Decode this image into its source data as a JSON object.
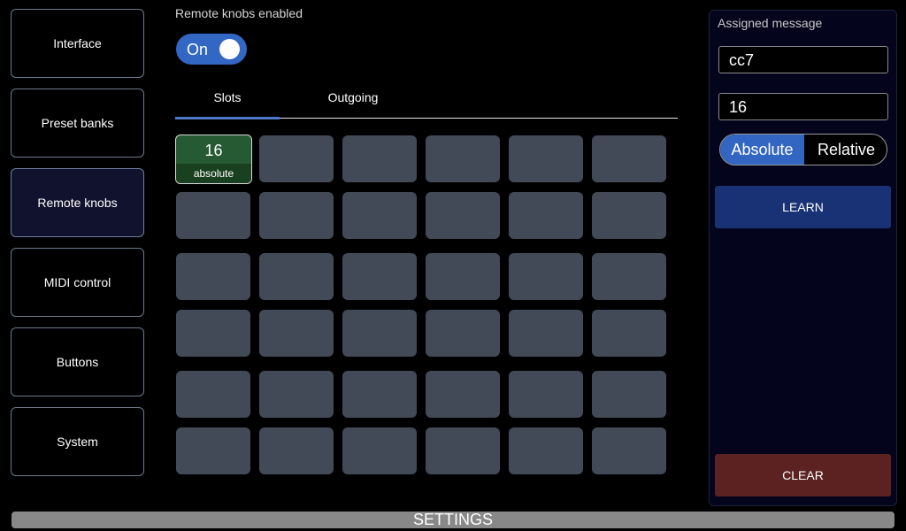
{
  "sidebar": {
    "items": [
      {
        "label": "Interface",
        "active": false
      },
      {
        "label": "Preset banks",
        "active": false
      },
      {
        "label": "Remote knobs",
        "active": true
      },
      {
        "label": "MIDI control",
        "active": false
      },
      {
        "label": "Buttons",
        "active": false
      },
      {
        "label": "System",
        "active": false
      }
    ]
  },
  "remote": {
    "enabled_label": "Remote knobs enabled",
    "toggle_label": "On",
    "toggle_on": true
  },
  "tabs": {
    "slots_label": "Slots",
    "outgoing_label": "Outgoing",
    "active": "Slots"
  },
  "slots": {
    "first": {
      "value": "16",
      "mode": "absolute"
    }
  },
  "panel": {
    "assigned_label": "Assigned message",
    "message_value": "cc7",
    "channel_value": "16",
    "absolute_label": "Absolute",
    "relative_label": "Relative",
    "mode_selected": "Absolute",
    "learn_label": "LEARN",
    "clear_label": "CLEAR"
  },
  "footer": {
    "settings_label": "SETTINGS"
  },
  "colors": {
    "accent": "#3367c4",
    "slot_empty": "#434a57",
    "slot_assigned": "#265a33",
    "learn": "#183275",
    "clear": "#5c2222"
  }
}
